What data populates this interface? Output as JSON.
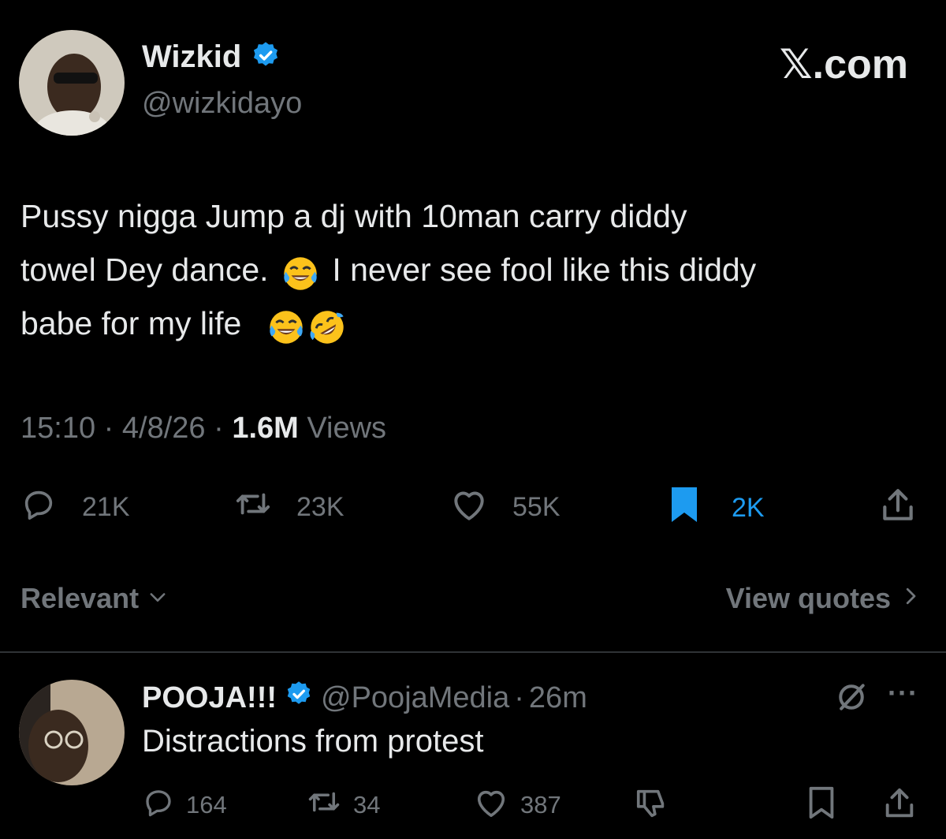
{
  "tweet": {
    "author_name": "Wizkid",
    "author_handle": "@wizkidayo",
    "brand": "𝕏.com",
    "text_line1": "Pussy nigga Jump a dj with 10man carry diddy",
    "text_line2a": "towel Dey dance.",
    "text_line2b": "I never see fool like this diddy",
    "text_line3": "babe for my life",
    "time": "15:10",
    "date": "4/8/26",
    "views_count": "1.6M",
    "views_label": "Views",
    "separator": "·",
    "replies": "21K",
    "reposts": "23K",
    "likes": "55K",
    "bookmarks": "2K"
  },
  "filters": {
    "sort_label": "Relevant",
    "quotes_label": "View quotes"
  },
  "reply": {
    "author_name": "POOJA!!!",
    "author_handle": "@PoojaMedia",
    "separator": "·",
    "age": "26m",
    "text": "Distractions from protest",
    "replies": "164",
    "reposts": "34",
    "likes": "387",
    "more_label": "···"
  },
  "colors": {
    "background": "#000000",
    "text": "#e7e9ea",
    "muted": "#71767b",
    "accent": "#1d9bf0",
    "divider": "#2f3336"
  },
  "icons": [
    "verified-badge-icon",
    "reply-icon",
    "repost-icon",
    "like-icon",
    "bookmark-icon",
    "share-icon",
    "chevron-down-icon",
    "chevron-right-icon",
    "grok-icon",
    "more-icon",
    "downvote-icon"
  ]
}
